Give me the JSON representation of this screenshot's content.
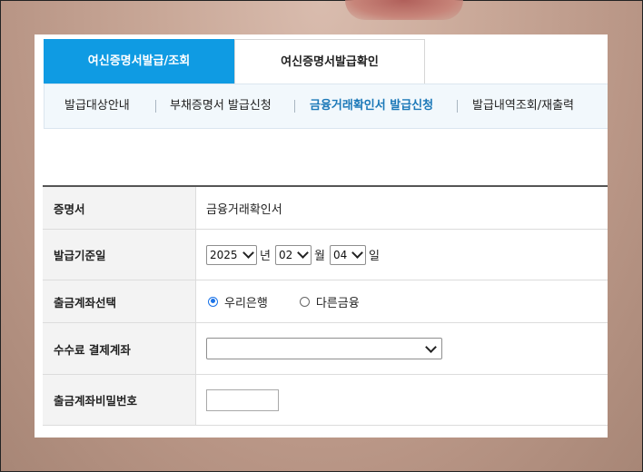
{
  "tabs": [
    {
      "label": "여신증명서발급/조회",
      "active": true
    },
    {
      "label": "여신증명서발급확인",
      "active": false
    }
  ],
  "subnav": [
    {
      "label": "발급대상안내",
      "active": false
    },
    {
      "label": "부채증명서 발급신청",
      "active": false
    },
    {
      "label": "금융거래확인서 발급신청",
      "active": true
    },
    {
      "label": "발급내역조회/재출력",
      "active": false
    }
  ],
  "form": {
    "certificate": {
      "label": "증명서",
      "value": "금융거래확인서"
    },
    "issue_date": {
      "label": "발급기준일",
      "year": "2025",
      "year_unit": "년",
      "month": "02",
      "month_unit": "월",
      "day": "04",
      "day_unit": "일"
    },
    "withdraw_account": {
      "label": "출금계좌선택",
      "options": [
        {
          "label": "우리은행",
          "checked": true
        },
        {
          "label": "다른금융",
          "checked": false
        }
      ]
    },
    "fee_account": {
      "label": "수수료 결제계좌",
      "selected": ""
    },
    "password": {
      "label": "출금계좌비밀번호",
      "value": ""
    }
  },
  "colors": {
    "accent": "#0f9be3",
    "active_subnav": "#1b78b8",
    "label_bg": "#f3f3f3"
  }
}
